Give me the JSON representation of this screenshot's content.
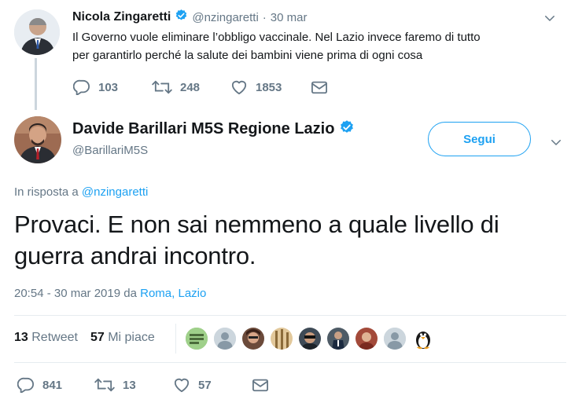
{
  "parent_tweet": {
    "name": "Nicola Zingaretti",
    "handle": "@nzingaretti",
    "separator": "·",
    "date": "30 mar",
    "text_line1": "Il Governo vuole eliminare l’obbligo vaccinale. Nel Lazio invece faremo di tutto",
    "text_line2": "per garantirlo perché la salute dei bambini viene prima di ogni cosa",
    "replies": "103",
    "retweets": "248",
    "likes": "1853"
  },
  "main_tweet": {
    "name": "Davide Barillari M5S Regione Lazio",
    "handle": "@BarillariM5S",
    "follow_label": "Segui",
    "reply_to_prefix": "In risposta a",
    "reply_to_handle": "@nzingaretti",
    "text_line1": "Provaci. E non sai nemmeno a quale livello di",
    "text_line2": "guerra andrai incontro.",
    "timestamp": "20:54 - 30 mar 2019",
    "from_label": "da",
    "location": "Roma, Lazio",
    "retweet_count": "13",
    "retweet_label": "Retweet",
    "like_count": "57",
    "like_label": "Mi piace",
    "replies": "841",
    "retweets": "13",
    "likes": "57"
  },
  "colors": {
    "accent": "#1da1f2",
    "muted": "#657786",
    "thread_line": "#ccd6dd"
  },
  "icons": [
    "verified-badge-icon",
    "chevron-down-icon",
    "reply-icon",
    "retweet-icon",
    "like-icon",
    "direct-message-icon"
  ]
}
